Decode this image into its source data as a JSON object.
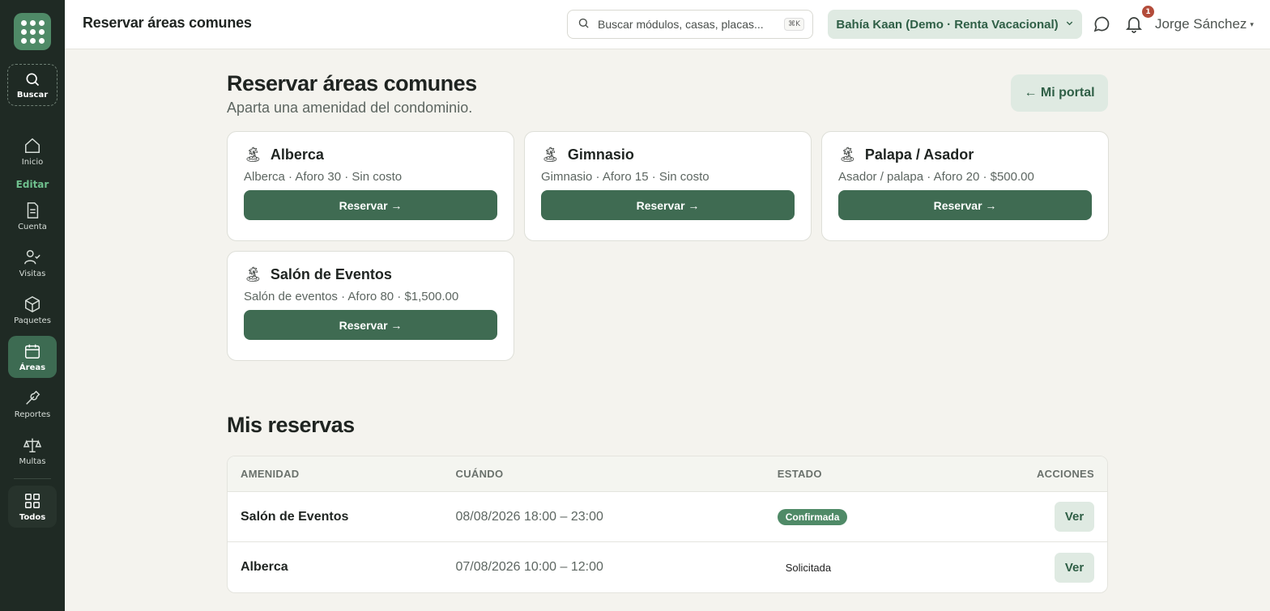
{
  "sidebar": {
    "search_label": "Buscar",
    "section_label": "Editar",
    "items": [
      {
        "label": "Inicio",
        "icon": "home-icon"
      },
      {
        "label": "Cuenta",
        "icon": "document-icon"
      },
      {
        "label": "Visitas",
        "icon": "user-check-icon"
      },
      {
        "label": "Paquetes",
        "icon": "package-icon"
      },
      {
        "label": "Áreas",
        "icon": "calendar-icon"
      },
      {
        "label": "Reportes",
        "icon": "wrench-icon"
      },
      {
        "label": "Multas",
        "icon": "scale-icon"
      },
      {
        "label": "Todos",
        "icon": "grid-icon"
      }
    ]
  },
  "topbar": {
    "title": "Reservar áreas comunes",
    "search_placeholder": "Buscar módulos, casas, placas...",
    "shortcut": "⌘K",
    "tenant": "Bahía Kaan (Demo · Renta Vacacional)",
    "notification_count": "1",
    "user": "Jorge Sánchez"
  },
  "header": {
    "title": "Reservar áreas comunes",
    "subtitle": "Aparta una amenidad del condominio.",
    "portal_button": "← Mi portal"
  },
  "amenities": [
    {
      "name": "Alberca",
      "meta": "Alberca · Aforo 30 · Sin costo",
      "button": "Reservar →"
    },
    {
      "name": "Gimnasio",
      "meta": "Gimnasio · Aforo 15 · Sin costo",
      "button": "Reservar →"
    },
    {
      "name": "Palapa / Asador",
      "meta": "Asador / palapa · Aforo 20 · $500.00",
      "button": "Reservar →"
    },
    {
      "name": "Salón de Eventos",
      "meta": "Salón de eventos · Aforo 80 · $1,500.00",
      "button": "Reservar →"
    }
  ],
  "reservations": {
    "title": "Mis reservas",
    "columns": [
      "AMENIDAD",
      "CUÁNDO",
      "ESTADO",
      "ACCIONES"
    ],
    "rows": [
      {
        "amenity": "Salón de Eventos",
        "when": "08/08/2026 18:00 – 23:00",
        "status": "Confirmada",
        "action": "Ver"
      },
      {
        "amenity": "Alberca",
        "when": "07/08/2026 10:00 – 12:00",
        "status": "Solicitada",
        "action": "Ver"
      }
    ]
  },
  "colors": {
    "sidebar_bg": "#1f2a24",
    "accent": "#3f6b52",
    "accent_light": "#dfeae2",
    "confirmed": "#4f8a67",
    "badge": "#b34c3a"
  }
}
